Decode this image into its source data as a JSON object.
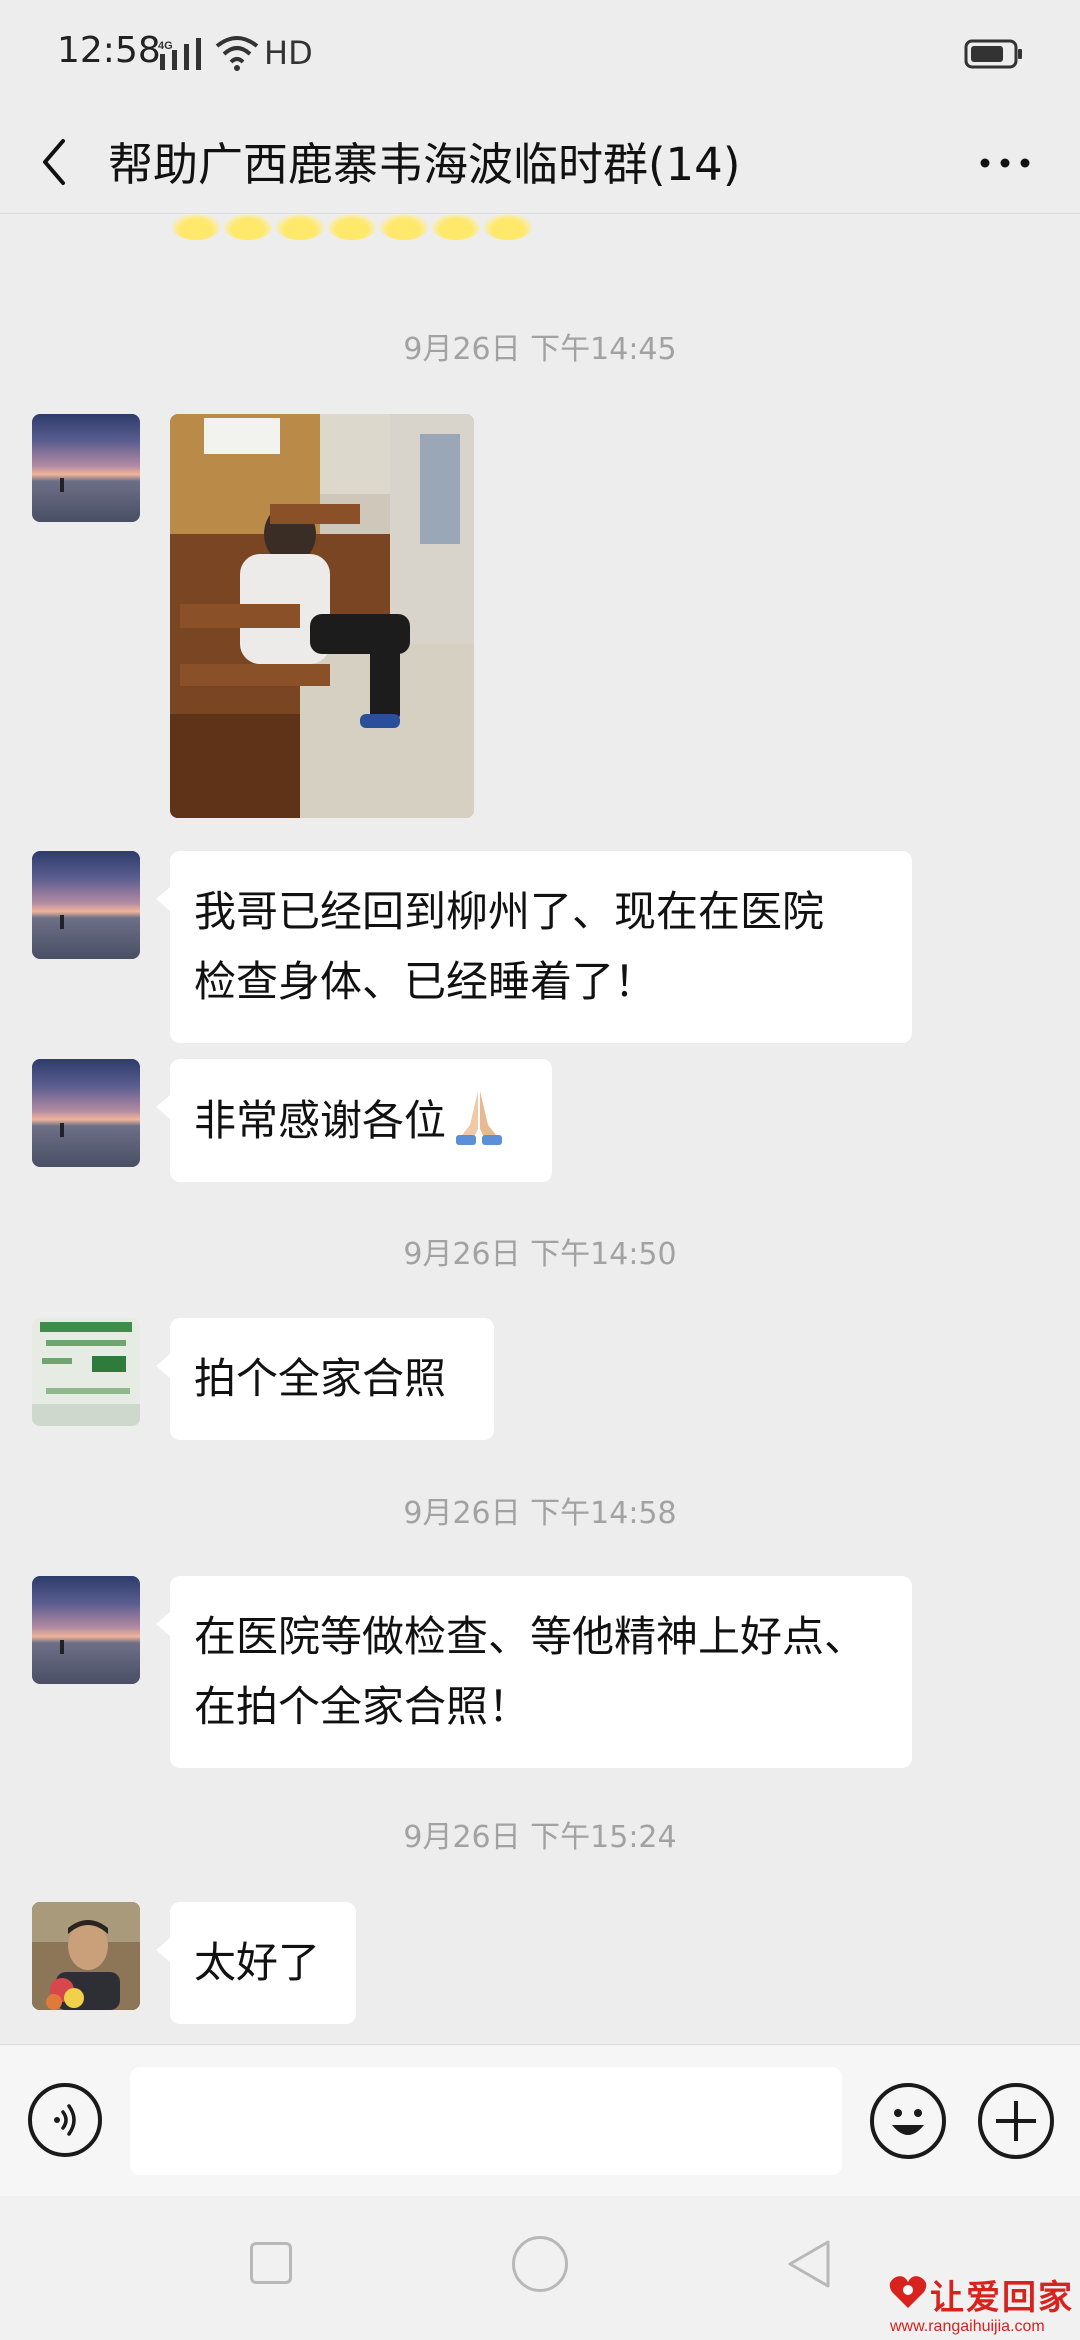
{
  "status_bar": {
    "time": "12:58",
    "signal_label": "4G",
    "network_label": "HD"
  },
  "header": {
    "title": "帮助广西鹿寨韦海波临时群(14)"
  },
  "messages": [
    {
      "time": "9月26日 下午14:45"
    },
    {
      "type": "image",
      "sender": "sunset-avatar"
    },
    {
      "type": "text",
      "sender": "sunset-avatar",
      "lines": [
        "我哥已经回到柳州了、现在在医院",
        "检查身体、已经睡着了！"
      ]
    },
    {
      "type": "text",
      "sender": "sunset-avatar",
      "text": "非常感谢各位",
      "emoji": "folded-hands"
    },
    {
      "time": "9月26日 下午14:50"
    },
    {
      "type": "text",
      "sender": "green-avatar",
      "text": "拍个全家合照"
    },
    {
      "time": "9月26日 下午14:58"
    },
    {
      "type": "text",
      "sender": "sunset-avatar",
      "lines": [
        "在医院等做检查、等他精神上好点、",
        "在拍个全家合照！"
      ]
    },
    {
      "time": "9月26日 下午15:24"
    },
    {
      "type": "text",
      "sender": "person-avatar",
      "text": "太好了"
    }
  ],
  "input_bar": {
    "placeholder": ""
  },
  "watermark": {
    "text": "让爱回家",
    "url": "www.rangaihuijia.com"
  },
  "colors": {
    "background": "#ededed",
    "bubble": "#ffffff",
    "timestamp": "#a2a2a2",
    "watermark": "#d8221e"
  },
  "icons": [
    "signal-icon",
    "wifi-icon",
    "battery-icon",
    "back-arrow-icon",
    "more-dots-icon",
    "voice-icon",
    "emoji-icon",
    "plus-icon",
    "folded-hands-emoji"
  ]
}
